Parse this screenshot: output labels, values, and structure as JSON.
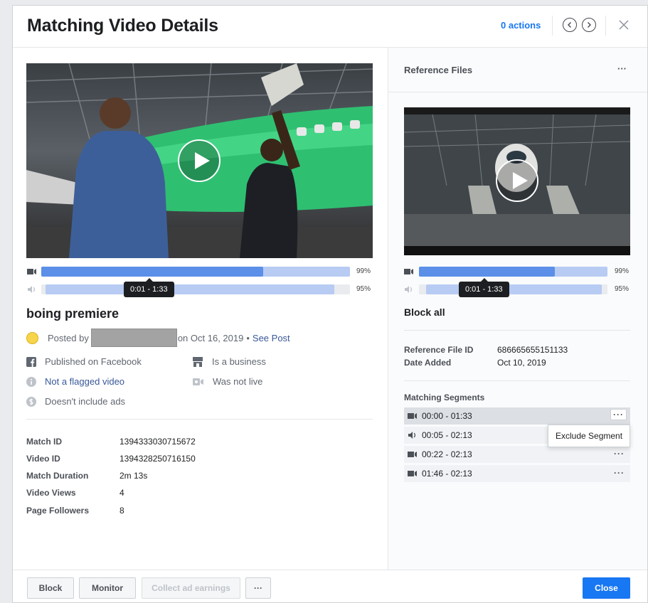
{
  "header": {
    "title": "Matching Video Details",
    "actions_label": "0 actions"
  },
  "left": {
    "video_bar_pct": "99%",
    "audio_bar_pct": "95%",
    "video_fill": 0.72,
    "audio_fill": 0.95,
    "tooltip": "0:01 - 1:33",
    "video_title": "boing premiere",
    "posted_by_label": "Posted by",
    "posted_on": "on Oct 16, 2019",
    "bullet": "•",
    "see_post": "See Post",
    "facts": {
      "published": "Published on Facebook",
      "business": "Is a business",
      "flagged": "Not a flagged video",
      "live": "Was not live",
      "ads": "Doesn't include ads"
    },
    "details": [
      {
        "label": "Match ID",
        "value": "1394333030715672"
      },
      {
        "label": "Video ID",
        "value": "1394328250716150"
      },
      {
        "label": "Match Duration",
        "value": "2m 13s"
      },
      {
        "label": "Video Views",
        "value": "4"
      },
      {
        "label": "Page Followers",
        "value": "8"
      }
    ]
  },
  "right": {
    "section_title": "Reference Files",
    "more_label": "···",
    "video_bar_pct": "99%",
    "audio_bar_pct": "95%",
    "video_fill": 0.72,
    "audio_fill": 0.97,
    "tooltip": "0:01 - 1:33",
    "policy": "Block all",
    "ref_file_id_label": "Reference File ID",
    "ref_file_id": "686665655151133",
    "date_added_label": "Date Added",
    "date_added": "Oct 10, 2019",
    "segments_title": "Matching Segments",
    "segments": [
      {
        "type": "video",
        "range": "00:00 - 01:33"
      },
      {
        "type": "audio",
        "range": "00:05 - 02:13"
      },
      {
        "type": "video",
        "range": "00:22 - 02:13"
      },
      {
        "type": "video",
        "range": "01:46 - 02:13"
      }
    ],
    "segment_menu_item": "Exclude Segment"
  },
  "footer": {
    "block": "Block",
    "monitor": "Monitor",
    "collect": "Collect ad earnings",
    "more": "···",
    "close": "Close"
  }
}
